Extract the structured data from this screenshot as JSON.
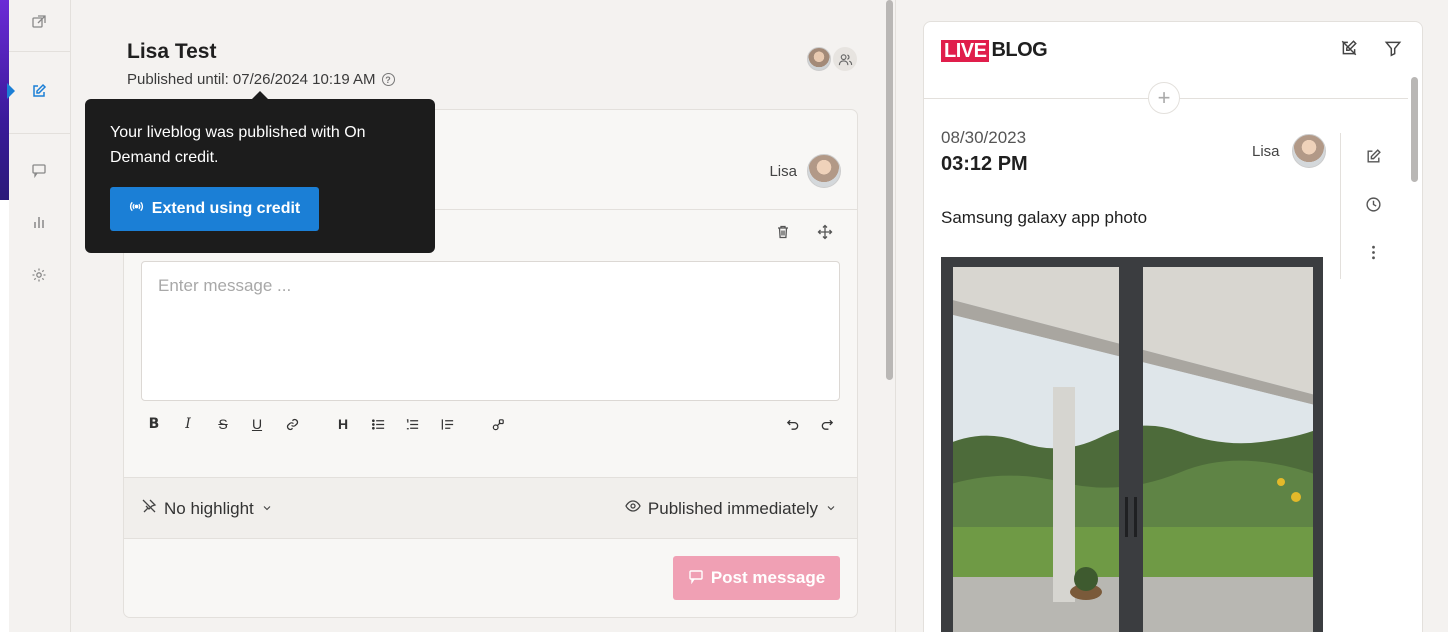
{
  "editor": {
    "title": "Lisa Test",
    "published_until": "Published until: 07/26/2024 10:19 AM",
    "card_author": "Lisa",
    "message_placeholder": "Enter message ...",
    "highlight_label": "No highlight",
    "publish_label": "Published immediately",
    "post_button": "Post message"
  },
  "popover": {
    "message": "Your liveblog was published with On Demand credit.",
    "extend_button": "Extend using credit"
  },
  "preview": {
    "brand_live": "LIVE",
    "brand_blog": "BLOG",
    "entry_date": "08/30/2023",
    "entry_time": "03:12 PM",
    "entry_author": "Lisa",
    "entry_text": "Samsung galaxy app photo"
  },
  "colors": {
    "accent_blue": "#1b7fd6",
    "brand_red": "#e01e4b",
    "post_button_disabled": "#f0a0b4"
  }
}
